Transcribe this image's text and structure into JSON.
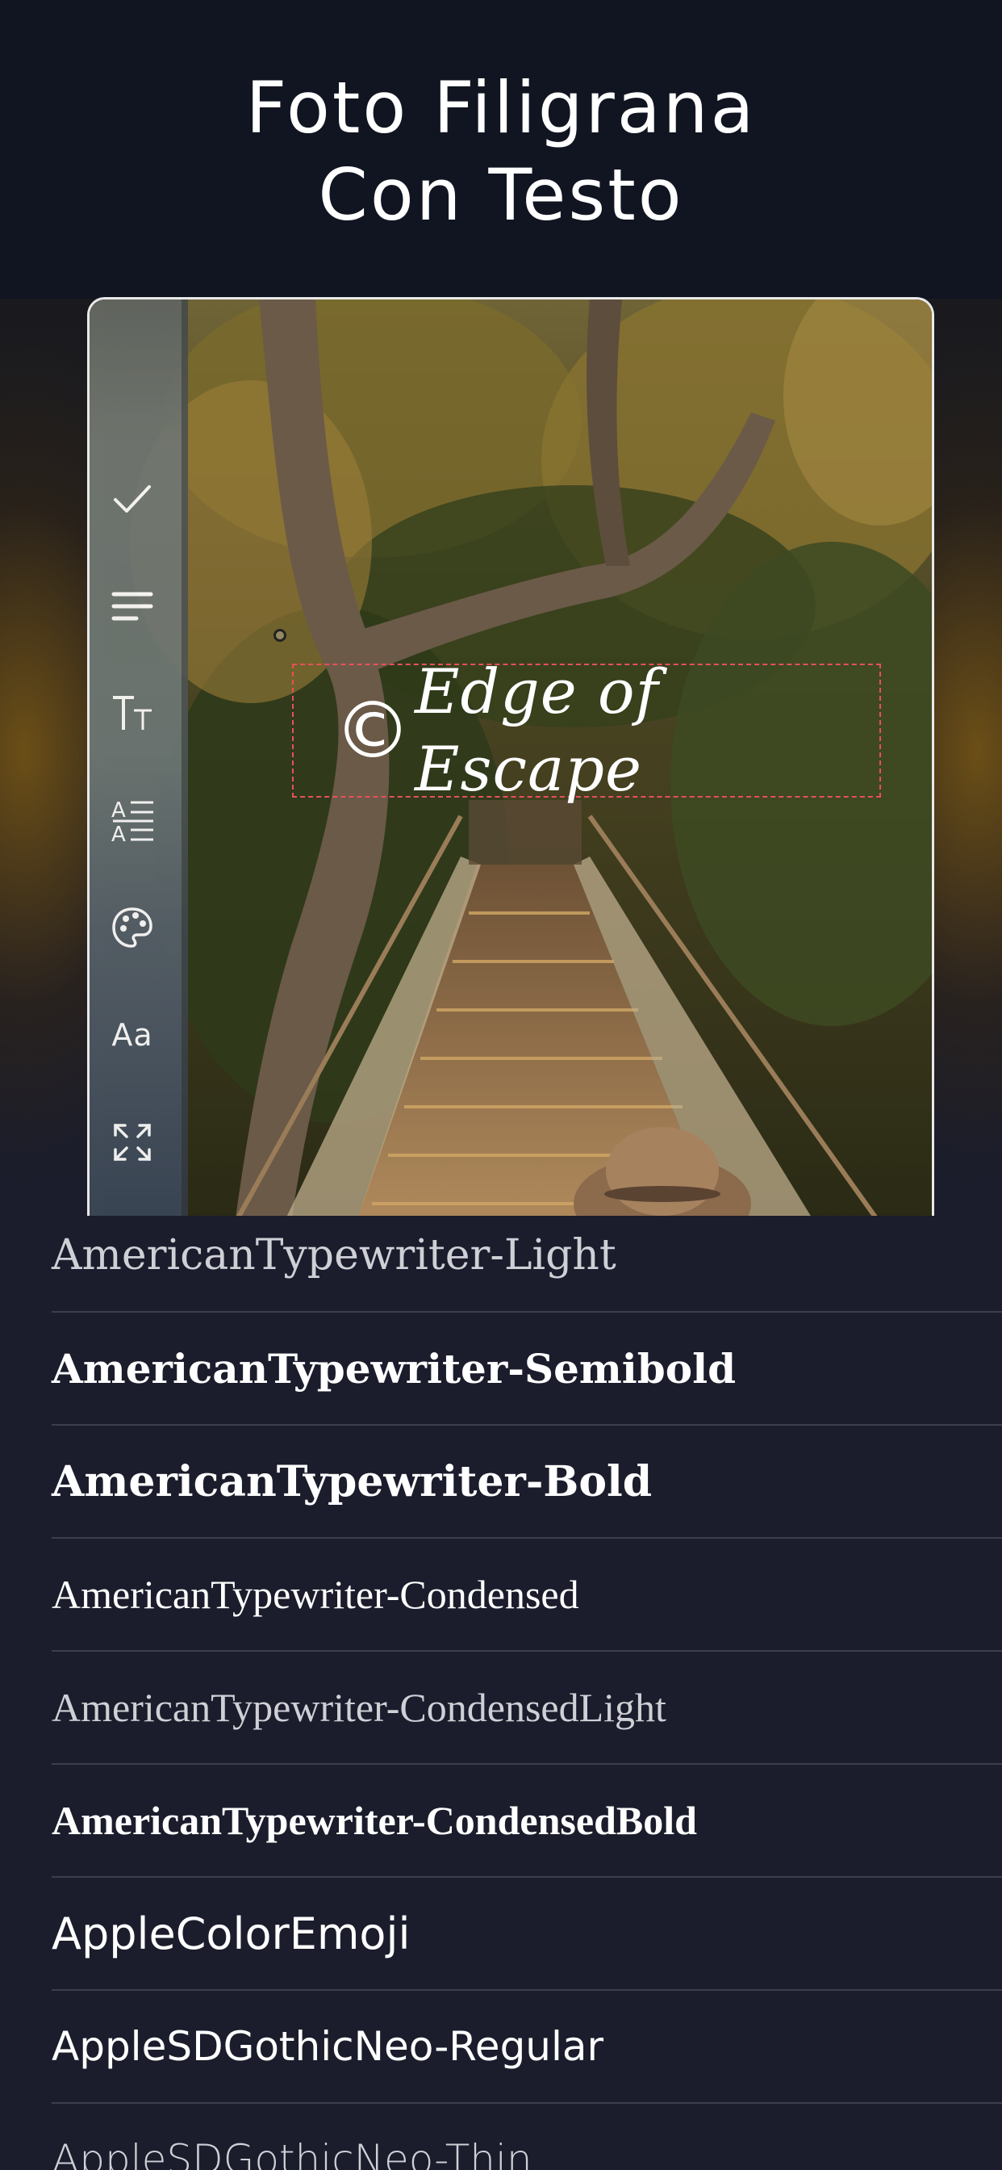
{
  "header": {
    "title_line1": "Foto Filigrana",
    "title_line2": "Con Testo"
  },
  "toolbar": {
    "items": [
      {
        "name": "confirm",
        "icon": "checkmark-icon"
      },
      {
        "name": "alignment",
        "icon": "align-left-icon"
      },
      {
        "name": "text-size",
        "icon": "text-size-icon"
      },
      {
        "name": "line-spacing",
        "icon": "line-spacing-icon"
      },
      {
        "name": "color",
        "icon": "palette-icon"
      },
      {
        "name": "font",
        "icon": "font-icon",
        "label": "Aa"
      },
      {
        "name": "resize",
        "icon": "expand-icon"
      }
    ]
  },
  "watermark": {
    "symbol": "©",
    "text": "Edge of Escape",
    "border_color": "#e8505b"
  },
  "font_list": {
    "items": [
      "AmericanTypewriter-Light",
      "AmericanTypewriter-Semibold",
      "AmericanTypewriter-Bold",
      "AmericanTypewriter-Condensed",
      "AmericanTypewriter-CondensedLight",
      "AmericanTypewriter-CondensedBold",
      "AppleColorEmoji",
      "AppleSDGothicNeo-Regular",
      "AppleSDGothicNeo-Thin"
    ]
  },
  "colors": {
    "header_bg": "#101521",
    "list_bg": "#1b1d2c",
    "divider": "#3b3e4d",
    "text": "#ffffff"
  }
}
